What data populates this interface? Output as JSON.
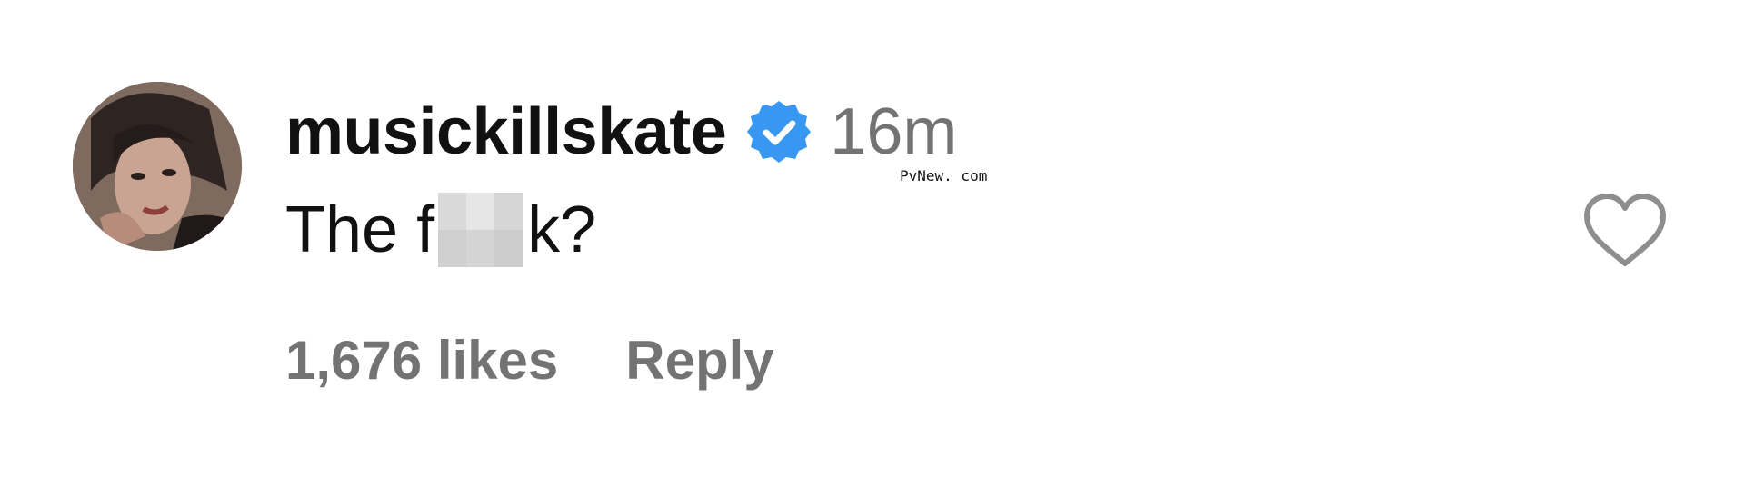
{
  "comment": {
    "username": "musickillskate",
    "verified": true,
    "timestamp": "16m",
    "text_before": "The f",
    "text_after": "k?",
    "likes": "1,676 likes",
    "reply_label": "Reply"
  },
  "watermark": "PvNew. com",
  "colors": {
    "verified_badge": "#3897f0",
    "secondary_text": "#737373",
    "primary_text": "#111111"
  },
  "icons": {
    "verified": "verified-badge-icon",
    "like": "heart-icon"
  }
}
